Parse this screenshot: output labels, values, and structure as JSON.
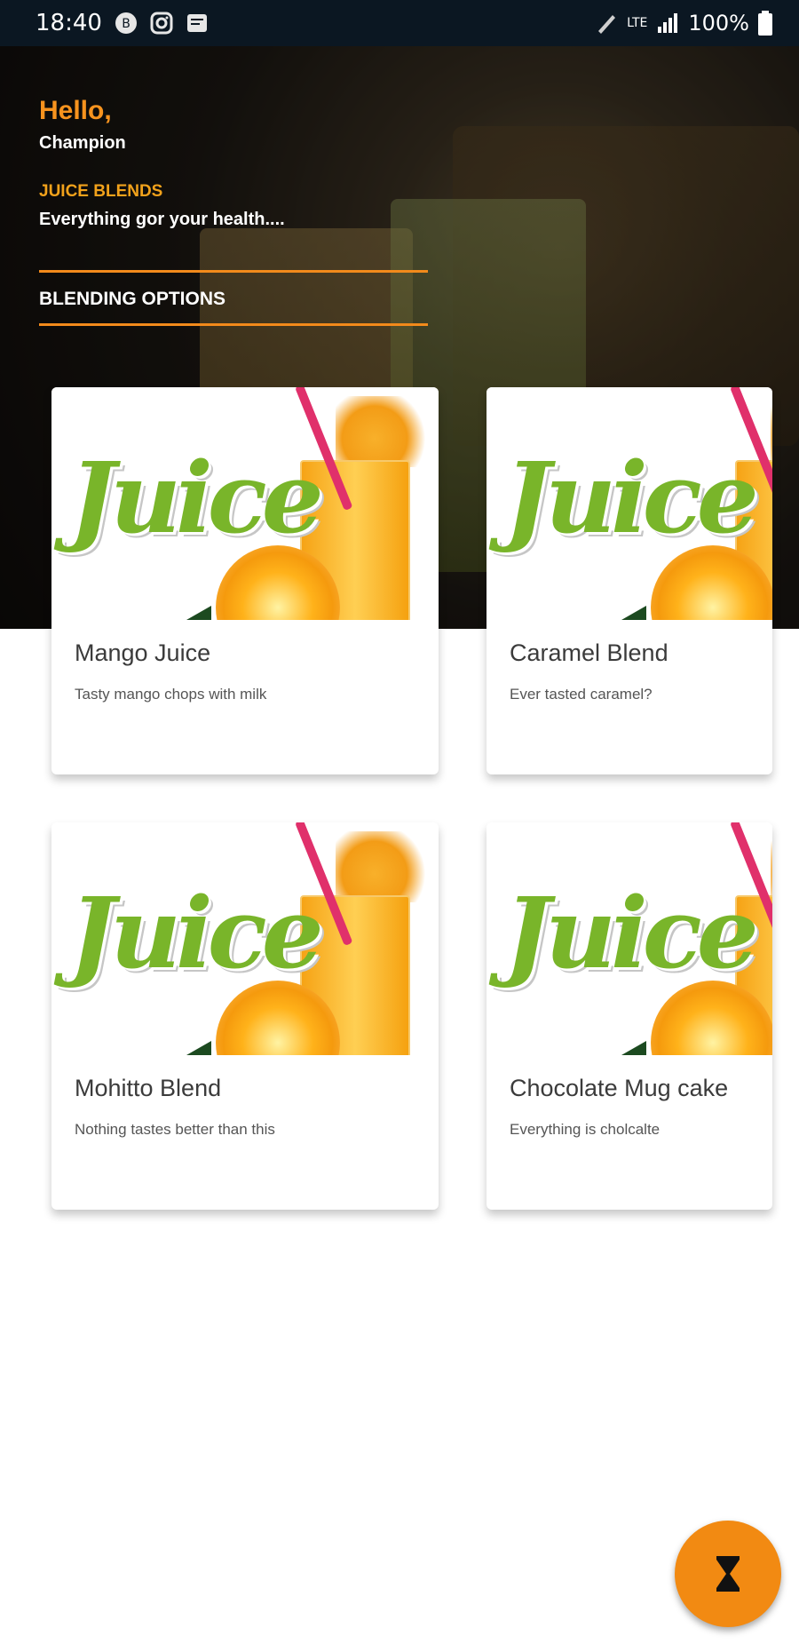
{
  "status_bar": {
    "time": "18:40",
    "battery": "100%",
    "network": "LTE"
  },
  "header": {
    "greeting": "Hello,",
    "username": "Champion",
    "section_title": "JUICE BLENDS",
    "section_subtitle": "Everything gor your health....",
    "options_label": "BLENDING OPTIONS"
  },
  "cards": [
    {
      "title": "Mango Juice",
      "description": "Tasty mango chops with milk",
      "image_text": "Juice"
    },
    {
      "title": "Caramel Blend",
      "description": "Ever tasted caramel?",
      "image_text": "Juice"
    },
    {
      "title": "Mohitto Blend",
      "description": "Nothing tastes better than this",
      "image_text": "Juice"
    },
    {
      "title": "Chocolate Mug cake",
      "description": "Everything is cholcalte",
      "image_text": "Juice"
    }
  ],
  "colors": {
    "accent": "#f28a12",
    "brand_green": "#79b52a",
    "status_bar": "#0b1722"
  },
  "fab": {
    "icon": "hourglass-icon"
  }
}
